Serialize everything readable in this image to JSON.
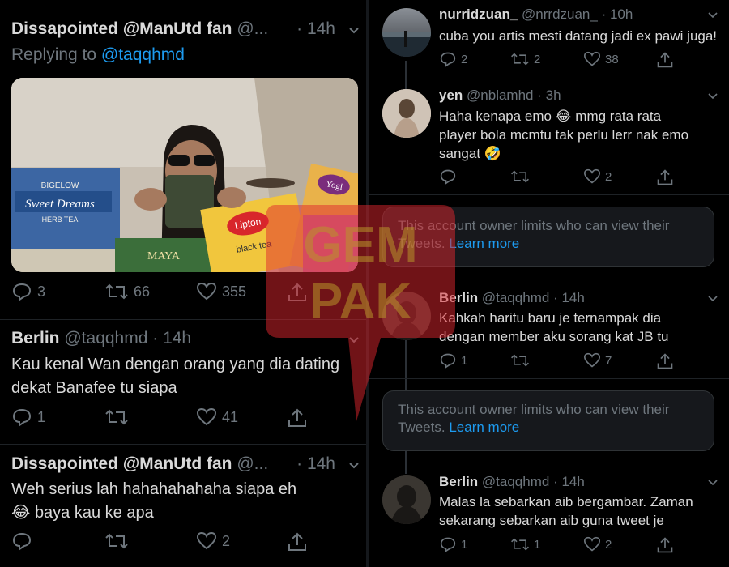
{
  "left": {
    "tweets": [
      {
        "author": "Dissapointed @ManUtd fan",
        "handle": "@...",
        "time": "· 14h",
        "replying_prefix": "Replying to",
        "replying_handle": "@taqqhmd",
        "media": {
          "box1_brand": "BIGELOW",
          "box1_title": "Sweet Dreams",
          "box1_sub": "HERB TEA",
          "box2_brand": "Lipton",
          "box2_sub": "black tea",
          "box3_brand": "Yogi",
          "box4_brand": "MAYA"
        },
        "reply_count": "3",
        "retweet_count": "66",
        "like_count": "355"
      },
      {
        "author": "Berlin",
        "handle": "@taqqhmd",
        "time": "· 14h",
        "text": "Kau kenal Wan dengan orang yang dia dating dekat Banafee tu siapa",
        "reply_count": "1",
        "retweet_count": "",
        "like_count": "41"
      },
      {
        "author": "Dissapointed @ManUtd fan",
        "handle": "@...",
        "time": "· 14h",
        "text_line1": "Weh serius lah hahahahahaha siapa eh",
        "text_line2": "baya kau ke apa",
        "emoji": "😂",
        "reply_count": "",
        "retweet_count": "",
        "like_count": "2"
      }
    ]
  },
  "right": {
    "tweets": [
      {
        "author": "nurridzuan_",
        "handle": "@nrrdzuan_",
        "time": "· 10h",
        "text": "cuba you artis mesti datang jadi ex pawi juga!",
        "reply_count": "2",
        "retweet_count": "2",
        "like_count": "38"
      },
      {
        "author": "yen",
        "handle": "@nblamhd",
        "time": "· 3h",
        "text_line1a": "Haha kenapa emo",
        "emoji1": "😂",
        "text_line1b": "mmg rata rata",
        "text_line2": "player bola mcmtu tak perlu lerr nak emo",
        "text_line3": "sangat",
        "emoji2": "🤣",
        "reply_count": "",
        "retweet_count": "",
        "like_count": "2"
      },
      {
        "limited_text": "This account owner limits who can view their Tweets.",
        "limited_link": "Learn more"
      },
      {
        "author": "Berlin",
        "handle": "@taqqhmd",
        "time": "· 14h",
        "text_line1": "Kahkah haritu baru je ternampak dia",
        "text_line2": "dengan member aku sorang kat JB tu",
        "reply_count": "1",
        "retweet_count": "",
        "like_count": "7"
      },
      {
        "limited_text": "This account owner limits who can view their Tweets.",
        "limited_link": "Learn more"
      },
      {
        "author": "Berlin",
        "handle": "@taqqhmd",
        "time": "· 14h",
        "text_line1": "Malas la sebarkan aib bergambar. Zaman",
        "text_line2": "sekarang sebarkan aib guna tweet je",
        "reply_count": "1",
        "retweet_count": "1",
        "like_count": "2"
      }
    ]
  },
  "watermark": {
    "line1": "GEM",
    "line2": "PAK"
  },
  "colors": {
    "background": "#000000",
    "muted": "#6e767d",
    "link": "#1d9bf0",
    "text": "#d9d9d9",
    "watermark": "#e0262d"
  }
}
